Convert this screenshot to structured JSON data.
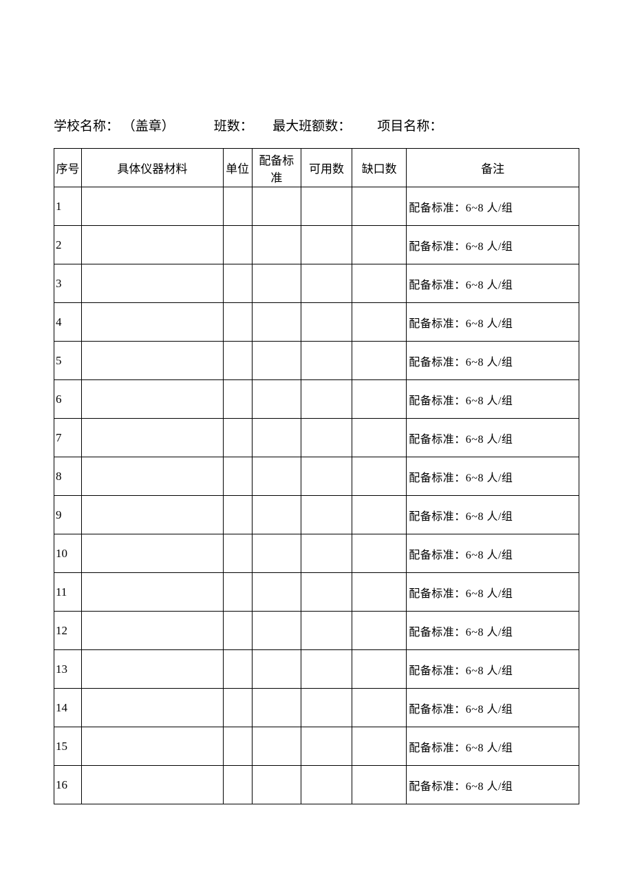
{
  "header": {
    "school_label": "学校名称：",
    "seal_label": "（盖章）",
    "class_count_label": "班数：",
    "max_class_size_label": "最大班额数：",
    "project_name_label": "项目名称："
  },
  "table": {
    "columns": {
      "seq": "序号",
      "material": "具体仪器材料",
      "unit": "单位",
      "standard": "配备标准",
      "available": "可用数",
      "shortage": "缺口数",
      "remark": "备注"
    },
    "rows": [
      {
        "seq": "1",
        "material": "",
        "unit": "",
        "standard": "",
        "available": "",
        "shortage": "",
        "remark": "配备标准：6~8 人/组"
      },
      {
        "seq": "2",
        "material": "",
        "unit": "",
        "standard": "",
        "available": "",
        "shortage": "",
        "remark": "配备标准：6~8 人/组"
      },
      {
        "seq": "3",
        "material": "",
        "unit": "",
        "standard": "",
        "available": "",
        "shortage": "",
        "remark": "配备标准：6~8 人/组"
      },
      {
        "seq": "4",
        "material": "",
        "unit": "",
        "standard": "",
        "available": "",
        "shortage": "",
        "remark": "配备标准：6~8 人/组"
      },
      {
        "seq": "5",
        "material": "",
        "unit": "",
        "standard": "",
        "available": "",
        "shortage": "",
        "remark": "配备标准：6~8 人/组"
      },
      {
        "seq": "6",
        "material": "",
        "unit": "",
        "standard": "",
        "available": "",
        "shortage": "",
        "remark": "配备标准：6~8 人/组"
      },
      {
        "seq": "7",
        "material": "",
        "unit": "",
        "standard": "",
        "available": "",
        "shortage": "",
        "remark": "配备标准：6~8 人/组"
      },
      {
        "seq": "8",
        "material": "",
        "unit": "",
        "standard": "",
        "available": "",
        "shortage": "",
        "remark": "配备标准：6~8 人/组"
      },
      {
        "seq": "9",
        "material": "",
        "unit": "",
        "standard": "",
        "available": "",
        "shortage": "",
        "remark": "配备标准：6~8 人/组"
      },
      {
        "seq": "10",
        "material": "",
        "unit": "",
        "standard": "",
        "available": "",
        "shortage": "",
        "remark": "配备标准：6~8 人/组"
      },
      {
        "seq": "11",
        "material": "",
        "unit": "",
        "standard": "",
        "available": "",
        "shortage": "",
        "remark": "配备标准：6~8 人/组"
      },
      {
        "seq": "12",
        "material": "",
        "unit": "",
        "standard": "",
        "available": "",
        "shortage": "",
        "remark": "配备标准：6~8 人/组"
      },
      {
        "seq": "13",
        "material": "",
        "unit": "",
        "standard": "",
        "available": "",
        "shortage": "",
        "remark": "配备标准：6~8 人/组"
      },
      {
        "seq": "14",
        "material": "",
        "unit": "",
        "standard": "",
        "available": "",
        "shortage": "",
        "remark": "配备标准：6~8 人/组"
      },
      {
        "seq": "15",
        "material": "",
        "unit": "",
        "standard": "",
        "available": "",
        "shortage": "",
        "remark": "配备标准：6~8 人/组"
      },
      {
        "seq": "16",
        "material": "",
        "unit": "",
        "standard": "",
        "available": "",
        "shortage": "",
        "remark": "配备标准：6~8 人/组"
      }
    ]
  }
}
